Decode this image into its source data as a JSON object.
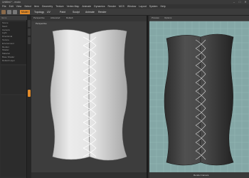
{
  "app": {
    "title": "Untitled * - modo"
  },
  "window": {
    "min": "–",
    "max": "□",
    "close": "✕"
  },
  "menubar": {
    "items": [
      "File",
      "Edit",
      "View",
      "Select",
      "Item",
      "Geometry",
      "Texture",
      "Vertex Map",
      "Animate",
      "Dynamics",
      "Render",
      "MCS",
      "Window",
      "Layout",
      "System",
      "Help"
    ]
  },
  "toolbar": {
    "tabs": [
      "Model",
      "Topology",
      "UV",
      "Paint",
      "Sculpt",
      "Animate",
      "Render"
    ]
  },
  "left_panel": {
    "header": "Items",
    "rows": [
      "Scene",
      "Mesh",
      "Camera",
      "Light",
      "Directional",
      "Texture",
      "Environment",
      "Render",
      "Shader",
      "Material",
      "Base Shader",
      "Default Layer"
    ]
  },
  "viewport_left": {
    "tabs": [
      "Perspective",
      "Advanced",
      "Default"
    ],
    "label": "Perspective"
  },
  "viewport_right": {
    "tabs": [
      "Preview",
      "Options"
    ],
    "footer_label": "Render Camera"
  },
  "colors": {
    "accent": "#e08a2a",
    "viewport_left_bg": "#3d3d3d",
    "viewport_right_bg": "#84a7a6",
    "mesh_light": "#e2e2e2",
    "mesh_dark": "#4a4a4a"
  }
}
